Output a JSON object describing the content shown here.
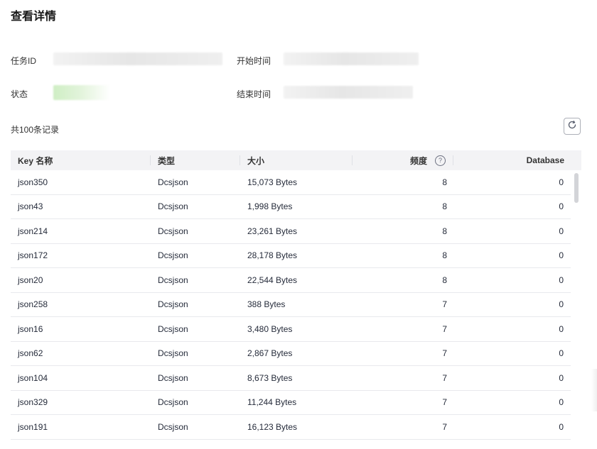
{
  "page": {
    "title": "查看详情"
  },
  "details": {
    "task_id_label": "任务ID",
    "start_time_label": "开始时间",
    "status_label": "状态",
    "end_time_label": "结束时间"
  },
  "records": {
    "count_text": "共100条记录"
  },
  "table": {
    "columns": {
      "key": "Key 名称",
      "type": "类型",
      "size": "大小",
      "frequency": "频度",
      "database": "Database"
    },
    "help_icon": "?",
    "rows": [
      {
        "key": "json350",
        "type": "Dcsjson",
        "size": "15,073 Bytes",
        "frequency": "8",
        "database": "0"
      },
      {
        "key": "json43",
        "type": "Dcsjson",
        "size": "1,998 Bytes",
        "frequency": "8",
        "database": "0"
      },
      {
        "key": "json214",
        "type": "Dcsjson",
        "size": "23,261 Bytes",
        "frequency": "8",
        "database": "0"
      },
      {
        "key": "json172",
        "type": "Dcsjson",
        "size": "28,178 Bytes",
        "frequency": "8",
        "database": "0"
      },
      {
        "key": "json20",
        "type": "Dcsjson",
        "size": "22,544 Bytes",
        "frequency": "8",
        "database": "0"
      },
      {
        "key": "json258",
        "type": "Dcsjson",
        "size": "388 Bytes",
        "frequency": "7",
        "database": "0"
      },
      {
        "key": "json16",
        "type": "Dcsjson",
        "size": "3,480 Bytes",
        "frequency": "7",
        "database": "0"
      },
      {
        "key": "json62",
        "type": "Dcsjson",
        "size": "2,867 Bytes",
        "frequency": "7",
        "database": "0"
      },
      {
        "key": "json104",
        "type": "Dcsjson",
        "size": "8,673 Bytes",
        "frequency": "7",
        "database": "0"
      },
      {
        "key": "json329",
        "type": "Dcsjson",
        "size": "11,244 Bytes",
        "frequency": "7",
        "database": "0"
      },
      {
        "key": "json191",
        "type": "Dcsjson",
        "size": "16,123 Bytes",
        "frequency": "7",
        "database": "0"
      }
    ]
  },
  "icons": {
    "refresh": "refresh-icon",
    "help": "question-circle-icon"
  },
  "colors": {
    "header_bg": "#f3f3f5",
    "status_green": "#cfeec4",
    "border": "#e8e9ed"
  }
}
